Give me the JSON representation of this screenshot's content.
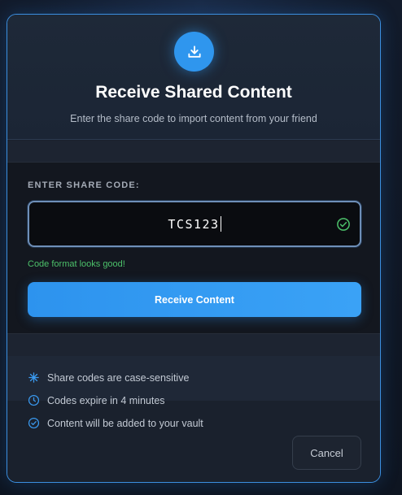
{
  "dialog": {
    "title": "Receive Shared Content",
    "subtitle": "Enter the share code to import content from your friend",
    "header_icon": "download-icon"
  },
  "form": {
    "label": "ENTER SHARE CODE:",
    "code_value": "TCS123",
    "valid_icon": "check-circle-icon",
    "hint": "Code format looks good!",
    "submit_label": "Receive Content"
  },
  "info": {
    "items": [
      {
        "icon": "asterisk-icon",
        "text": "Share codes are case-sensitive"
      },
      {
        "icon": "clock-icon",
        "text": "Codes expire in 4 minutes"
      },
      {
        "icon": "check-circle-icon",
        "text": "Content will be added to your vault"
      }
    ]
  },
  "actions": {
    "cancel_label": "Cancel"
  },
  "colors": {
    "accent": "#2f96ee",
    "success": "#4cc16a",
    "border": "#3b8fe0",
    "background": "#1a212d"
  }
}
